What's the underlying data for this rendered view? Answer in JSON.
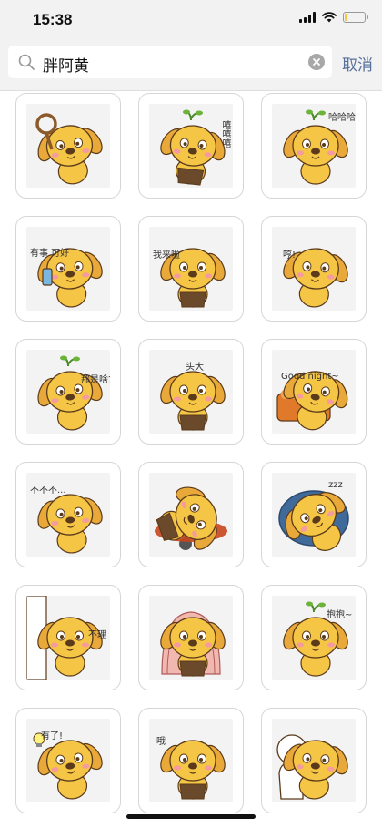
{
  "status_bar": {
    "time": "15:38",
    "signal_icon": "cellular-signal-icon",
    "wifi_icon": "wifi-icon",
    "battery_icon": "battery-icon",
    "battery_level": 0.15,
    "battery_color": "#f0c84a"
  },
  "search": {
    "query": "胖阿黄",
    "search_icon": "search-icon",
    "clear_icon": "clear-icon",
    "cancel_label": "取消",
    "cancel_color": "#56709b"
  },
  "stickers": [
    {
      "name": "dog-with-rope-crying",
      "caption": "",
      "props": "rope"
    },
    {
      "name": "dog-laughing-teeth",
      "caption": "嘻嘻嘻",
      "props": "sprout"
    },
    {
      "name": "dog-happy-squint",
      "caption": "哈哈哈哈",
      "props": "sprout"
    },
    {
      "name": "dog-on-phone",
      "caption": "有事 可好",
      "props": "phone"
    },
    {
      "name": "dog-sitting-exhausted",
      "caption": "我来啦",
      "props": ""
    },
    {
      "name": "dog-arms-crossed",
      "caption": "哼!",
      "props": ""
    },
    {
      "name": "dog-asking",
      "caption": "那是啥?",
      "props": "sprout"
    },
    {
      "name": "dog-headache",
      "caption": "头大",
      "props": ""
    },
    {
      "name": "dog-good-night",
      "caption": "Good night~",
      "props": "pillow"
    },
    {
      "name": "dog-no-no",
      "caption": "不不不...",
      "props": ""
    },
    {
      "name": "dog-lifting-weights",
      "caption": "",
      "props": "barbell"
    },
    {
      "name": "dog-sleeping-cushion",
      "caption": "zzz",
      "props": "cushion"
    },
    {
      "name": "dog-peeking-wall",
      "caption": "不理",
      "props": "wall"
    },
    {
      "name": "dog-blanket-phone",
      "caption": "",
      "props": "blanket"
    },
    {
      "name": "dog-hug-please",
      "caption": "抱抱~",
      "props": "sprout"
    },
    {
      "name": "dog-idea",
      "caption": "有了!",
      "props": "bulb"
    },
    {
      "name": "dog-surprised",
      "caption": "哦",
      "props": ""
    },
    {
      "name": "dog-hugging-friend",
      "caption": "",
      "props": "friend"
    }
  ],
  "colors": {
    "dog_body": "#f5c545",
    "dog_outline": "#5a3a1a",
    "ear": "#e8a93a",
    "cheek": "#f49aa0",
    "overall": "#6b4a2c"
  }
}
